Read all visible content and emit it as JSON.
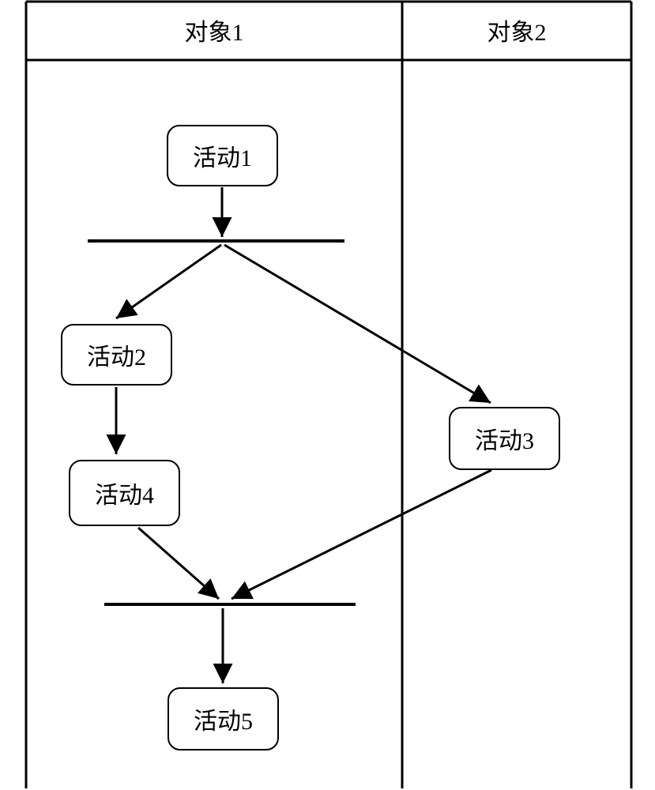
{
  "lanes": {
    "lane1": {
      "label": "对象1"
    },
    "lane2": {
      "label": "对象2"
    }
  },
  "nodes": {
    "a1": {
      "label": "活动1"
    },
    "a2": {
      "label": "活动2"
    },
    "a3": {
      "label": "活动3"
    },
    "a4": {
      "label": "活动4"
    },
    "a5": {
      "label": "活动5"
    }
  },
  "chart_data": {
    "type": "activity_diagram",
    "title": "",
    "lanes": [
      {
        "id": "lane1",
        "name": "对象1"
      },
      {
        "id": "lane2",
        "name": "对象2"
      }
    ],
    "nodes": [
      {
        "id": "a1",
        "name": "活动1",
        "lane": "lane1"
      },
      {
        "id": "fork1",
        "type": "fork",
        "lane": "lane1"
      },
      {
        "id": "a2",
        "name": "活动2",
        "lane": "lane1"
      },
      {
        "id": "a3",
        "name": "活动3",
        "lane": "lane2"
      },
      {
        "id": "a4",
        "name": "活动4",
        "lane": "lane1"
      },
      {
        "id": "join1",
        "type": "join",
        "lane": "lane1"
      },
      {
        "id": "a5",
        "name": "活动5",
        "lane": "lane1"
      }
    ],
    "edges": [
      {
        "from": "a1",
        "to": "fork1"
      },
      {
        "from": "fork1",
        "to": "a2"
      },
      {
        "from": "fork1",
        "to": "a3"
      },
      {
        "from": "a2",
        "to": "a4"
      },
      {
        "from": "a4",
        "to": "join1"
      },
      {
        "from": "a3",
        "to": "join1"
      },
      {
        "from": "join1",
        "to": "a5"
      }
    ]
  }
}
